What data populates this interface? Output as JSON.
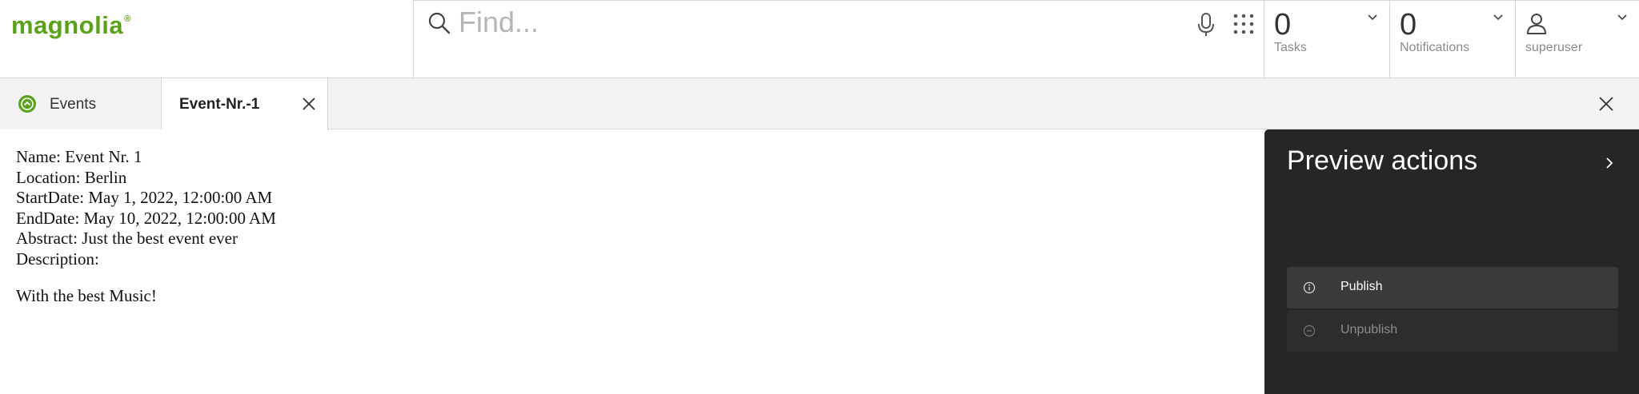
{
  "header": {
    "logo_text": "magnolia",
    "logo_mark": "®",
    "search": {
      "placeholder": "Find...",
      "value": ""
    },
    "tasks": {
      "count": "0",
      "label": "Tasks"
    },
    "notifications": {
      "count": "0",
      "label": "Notifications"
    },
    "user": {
      "name": "superuser"
    }
  },
  "tabs": [
    {
      "label": "Events",
      "icon": "app-icon"
    },
    {
      "label": "Event-Nr.-1",
      "active": true
    }
  ],
  "content": {
    "lines": [
      "Name: Event Nr. 1",
      "Location: Berlin",
      "StartDate: May 1, 2022, 12:00:00 AM",
      "EndDate: May 10, 2022, 12:00:00 AM",
      "Abstract: Just the best event ever",
      "Description:"
    ],
    "description_body": "With the best Music!"
  },
  "panel": {
    "title": "Preview actions",
    "actions": [
      {
        "label": "Publish",
        "enabled": true
      },
      {
        "label": "Unpublish",
        "enabled": false
      }
    ]
  },
  "colors": {
    "brand": "#5ba11c",
    "panel_bg": "#262626",
    "tabbar_bg": "#f3f3f3"
  }
}
